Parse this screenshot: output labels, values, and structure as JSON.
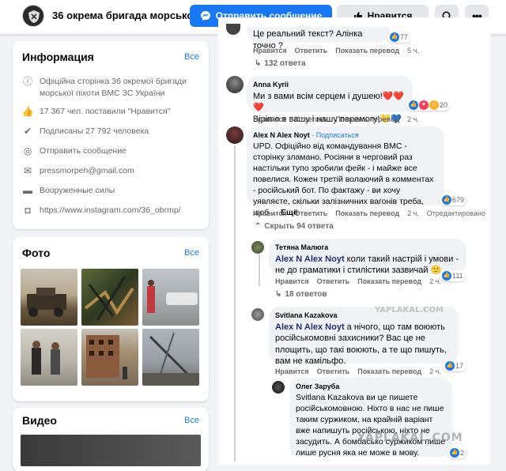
{
  "header": {
    "title": "36 окрема бригада морсько...",
    "message_button": "Отправить сообщение",
    "like_button": "Нравится",
    "search_icon": "search-icon",
    "more_icon": "more-icon"
  },
  "info": {
    "title": "Информация",
    "all": "Все",
    "description": "Офіційна сторінка 36 окремої бригади морської піхоти ВМС ЗС України",
    "likes": "17 367 чел. поставили \"Нравится\"",
    "followers": "Подписаны 27 792 человека",
    "send_message": "Отправить сообщение",
    "email": "pressmorpeh@gmail.com",
    "category": "Вооруженные силы",
    "instagram": "https://www.instagram.com/36_obrmp/"
  },
  "photos": {
    "title": "Фото",
    "all": "Все"
  },
  "video": {
    "title": "Видео",
    "all": "Все"
  },
  "comments": {
    "top": {
      "text": "Це реальний текст? Алінка точно ?",
      "reacts": "77",
      "like": "Нравится",
      "reply": "Ответить",
      "translate": "Показать перевод",
      "time": "5 ч.",
      "replies": "132 ответа"
    },
    "c1": {
      "name": "Anna Kyrii",
      "line1": "Ми з вами всім серцем і душею!❤️❤️❤️",
      "line2": "Вірimo в вашу і нашу перемогу!💛💙",
      "reacts": "20",
      "like": "Нравится",
      "reply": "Ответить",
      "translate": "Показать перевод",
      "time": "2 ч."
    },
    "c2": {
      "name": "Alex N Alex Noyt",
      "follow": "· Подписаться",
      "text": "UPD. Офіційно від командування ВМС - сторінку зламано. Росіяни в черговий раз настільки тупо зробили фейк - і майже все повелися. Кожен третій волаючий в комментах - російський бот. По фактажу - ви хочу уявляєте, скільки залізничних вагонів треба, щоб ... ",
      "more": "Ещё",
      "reacts": "679",
      "like": "Нравится",
      "reply": "Ответить",
      "translate": "Показать перевод",
      "time": "2 ч.",
      "edited": "Отредактировано",
      "hide": "Скрыть 94 ответа"
    },
    "r1": {
      "name": "Тетяна Малюга",
      "mention": "Alex N Alex Noyt",
      "text": " коли такий настрій і умови - не до граматики і стилістики зазвичай 🙂",
      "reacts": "111",
      "like": "Нравится",
      "reply": "Ответить",
      "translate": "Показать перевод",
      "time": "2 ч.",
      "replies": "18 ответов"
    },
    "r2": {
      "name": "Svitlana Kazakova",
      "mention": "Alex N Alex Noyt",
      "text": " а нічого, що там воюють російськомовні захисники? Вас це не площить, що такі воюють, а те що пишуть, вам не камільфо.",
      "reacts": "17",
      "like": "Нравится",
      "reply": "Ответить",
      "translate": "Показать перевод",
      "time": "2 ч."
    },
    "r3": {
      "name": "Олег Заруба",
      "text": "Svitlana Kazakova ви це пишете російськомовною. Ніхто в нас не пише таким суржиком, на крайній варіант вже напишуть російською, ніхто не засудить. А бомбасько суржиком пише лише русня яка не може в мову.",
      "reacts": "2"
    }
  },
  "watermark": "YAPLAKAL.COM",
  "watermark2": "YAPLAKAL.COM"
}
